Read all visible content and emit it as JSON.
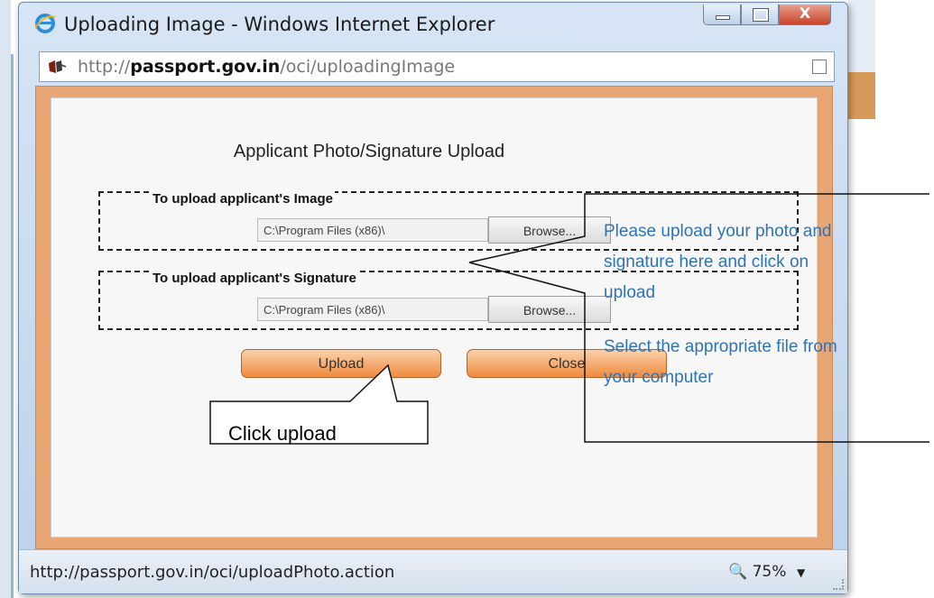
{
  "window": {
    "title": "Uploading Image - Windows Internet Explorer",
    "close_glyph": "X"
  },
  "address_bar": {
    "url_prefix": "http://",
    "url_domain": "passport.gov.in",
    "url_path": "/oci/uploadingImage"
  },
  "dialog": {
    "heading": "Applicant Photo/Signature Upload",
    "image_section": {
      "label": "To upload applicant's Image",
      "file_value": "C:\\Program Files (x86)\\",
      "browse_label": "Browse..."
    },
    "signature_section": {
      "label": "To upload applicant's Signature",
      "file_value": "C:\\Program Files (x86)\\",
      "browse_label": "Browse..."
    },
    "upload_label": "Upload",
    "close_label": "Close"
  },
  "status_bar": {
    "url": "http://passport.gov.in/oci/uploadPhoto.action",
    "zoom": "75%"
  },
  "annotations": {
    "note_upload_line1": "Please upload your photo and",
    "note_upload_line2": "signature here and click on",
    "note_upload_line3": "upload",
    "note_select_line1": "Select the appropriate file from",
    "note_select_line2": "your computer",
    "click_upload": "Click upload"
  },
  "colors": {
    "note_text": "#2e74b5",
    "button_orange": "#f08a3e",
    "frame_orange": "#e7a674"
  }
}
